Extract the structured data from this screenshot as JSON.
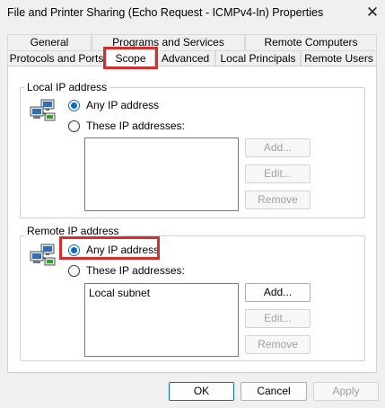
{
  "window": {
    "title": "File and Printer Sharing (Echo Request - ICMPv4-In) Properties",
    "close_glyph": "✕"
  },
  "tabs": {
    "row1": [
      {
        "label": "General"
      },
      {
        "label": "Programs and Services"
      },
      {
        "label": "Remote Computers"
      }
    ],
    "row2": [
      {
        "label": "Protocols and Ports"
      },
      {
        "label": "Scope",
        "active": true
      },
      {
        "label": "Advanced"
      },
      {
        "label": "Local Principals"
      },
      {
        "label": "Remote Users"
      }
    ]
  },
  "local_ip": {
    "legend": "Local IP address",
    "option_any": "Any IP address",
    "option_these": "These IP addresses:",
    "selected": "any",
    "list_items": [],
    "buttons": {
      "add": "Add...",
      "edit": "Edit...",
      "remove": "Remove"
    }
  },
  "remote_ip": {
    "legend": "Remote IP address",
    "option_any": "Any IP address",
    "option_these": "These IP addresses:",
    "selected": "any",
    "list_items": [
      "Local subnet"
    ],
    "buttons": {
      "add": "Add...",
      "edit": "Edit...",
      "remove": "Remove"
    }
  },
  "footer": {
    "ok": "OK",
    "cancel": "Cancel",
    "apply": "Apply"
  },
  "colors": {
    "accent": "#0f6cbd",
    "highlight": "#d62d2d"
  },
  "icons": [
    "network-computers-icon",
    "close-icon"
  ]
}
